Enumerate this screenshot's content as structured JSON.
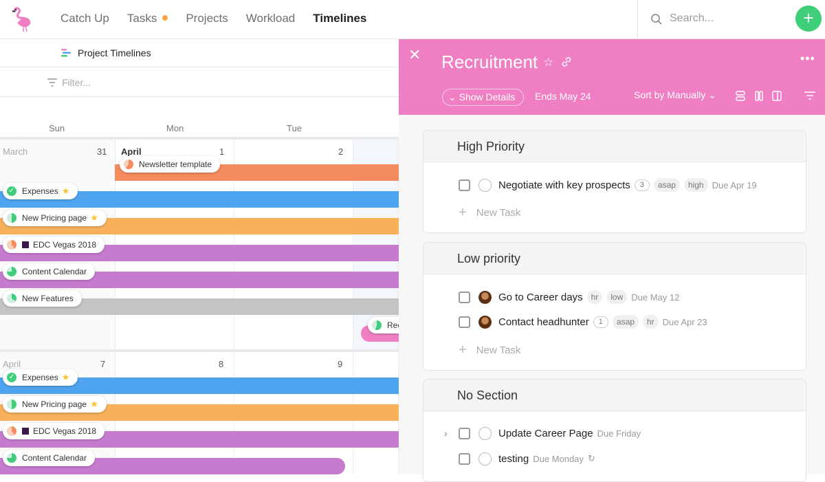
{
  "nav": {
    "tabs": [
      "Catch Up",
      "Tasks",
      "Projects",
      "Workload",
      "Timelines"
    ],
    "active": "Timelines"
  },
  "search": {
    "placeholder": "Search..."
  },
  "left": {
    "project_title": "Project Timelines",
    "filter_placeholder": "Filter...",
    "day_headers": [
      "Sun",
      "Mon",
      "Tue"
    ],
    "week1": {
      "month_left": "March",
      "month_right": "April",
      "days": [
        "31",
        "1",
        "2"
      ]
    },
    "week2": {
      "month_left": "April",
      "days": [
        "7",
        "8",
        "9"
      ]
    },
    "items": {
      "newsletter": "Newsletter template",
      "expenses": "Expenses",
      "pricing": "New Pricing page",
      "edc": "EDC Vegas 2018",
      "content": "Content Calendar",
      "features": "New Features",
      "rec": "Rec"
    },
    "colors": {
      "orange": "#f58c5e",
      "blue": "#4fa4ef",
      "yellow": "#f8b15a",
      "purple": "#c77bcf",
      "gray": "#c4c4c4",
      "pink": "#f07ec2"
    }
  },
  "panel": {
    "title": "Recruitment",
    "show_details": "Show Details",
    "ends": "Ends May 24",
    "sort": "Sort by Manually",
    "new_task": "New Task",
    "sections": [
      {
        "name": "High Priority",
        "tasks": [
          {
            "name": "Negotiate with key prospects",
            "count": "3",
            "tags": [
              "asap",
              "high"
            ],
            "due": "Due Apr 19"
          }
        ]
      },
      {
        "name": "Low priority",
        "tasks": [
          {
            "name": "Go to Career days",
            "tags": [
              "hr",
              "low"
            ],
            "due": "Due May 12"
          },
          {
            "name": "Contact headhunter",
            "count": "1",
            "tags": [
              "asap",
              "hr"
            ],
            "due": "Due Apr 23"
          }
        ]
      },
      {
        "name": "No Section",
        "tasks": [
          {
            "name": "Update Career Page",
            "due": "Due Friday"
          },
          {
            "name": "testing",
            "due": "Due Monday"
          }
        ]
      }
    ],
    "header_color": "#f07ec2"
  }
}
